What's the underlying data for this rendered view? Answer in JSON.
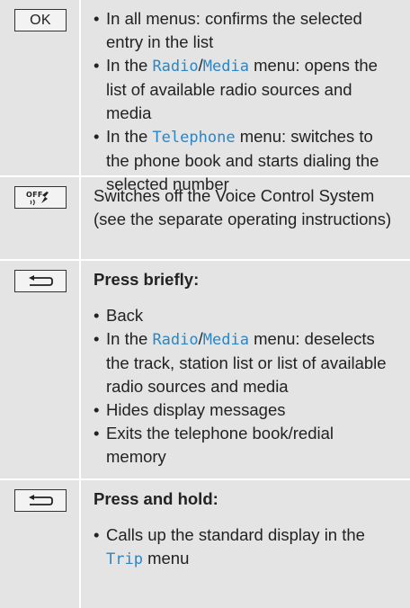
{
  "rows": [
    {
      "key_label": "OK",
      "key_icon": "ok-key",
      "items": [
        {
          "pre": "In all menus: confirms the selected entry in the list"
        },
        {
          "pre": "In the ",
          "m1": "Radio",
          "sep": "/",
          "m2": "Media",
          "post": " menu: opens the list of available radio sources and media"
        },
        {
          "pre": "In the ",
          "m1": "Telephone",
          "post": " menu: switches to the phone book and starts dial­ing the selected number"
        }
      ]
    },
    {
      "key_icon": "voice-control-off-icon",
      "key_icon_text": "OFF",
      "text": "Switches off the Voice Control Sys­tem (see the separate operating instructions)"
    },
    {
      "key_icon": "back-arrow-icon",
      "heading": "Press briefly:",
      "items": [
        {
          "pre": "Back"
        },
        {
          "pre": "In the ",
          "m1": "Radio",
          "sep": "/",
          "m2": "Media",
          "post": " menu: dese­lects the track, station list or list of available radio sources and media"
        },
        {
          "pre": "Hides display messages"
        },
        {
          "pre": "Exits the telephone book/redial memory"
        }
      ]
    },
    {
      "key_icon": "back-arrow-icon",
      "heading": "Press and hold:",
      "items": [
        {
          "pre": "Calls up the standard display in the ",
          "m1": "Trip",
          "post": " menu"
        }
      ]
    }
  ],
  "colors": {
    "accent": "#2a86c4",
    "row_bg": "#e4e4e4",
    "text": "#222222"
  }
}
